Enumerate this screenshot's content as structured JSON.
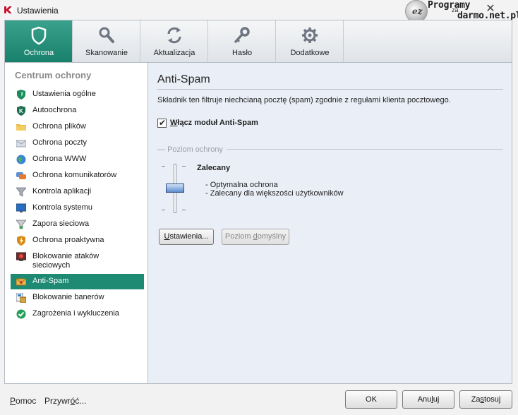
{
  "window": {
    "title": "Ustawienia",
    "close_glyph": "✕"
  },
  "watermark": {
    "logo_letter": "ez",
    "line1": "Programy",
    "line2": "za",
    "line3": "darmo.net.pl"
  },
  "tabs": [
    {
      "label": "Ochrona",
      "icon": "shield-icon",
      "active": true
    },
    {
      "label": "Skanowanie",
      "icon": "magnifier-icon",
      "active": false
    },
    {
      "label": "Aktualizacja",
      "icon": "refresh-icon",
      "active": false
    },
    {
      "label": "Hasło",
      "icon": "key-icon",
      "active": false
    },
    {
      "label": "Dodatkowe",
      "icon": "gear-icon",
      "active": false
    }
  ],
  "sidebar": {
    "title": "Centrum ochrony",
    "items": [
      {
        "label": "Ustawienia ogólne",
        "icon": "green-shield-icon"
      },
      {
        "label": "Autoochrona",
        "icon": "k-shield-icon"
      },
      {
        "label": "Ochrona plików",
        "icon": "folder-icon"
      },
      {
        "label": "Ochrona poczty",
        "icon": "envelope-icon"
      },
      {
        "label": "Ochrona WWW",
        "icon": "globe-icon"
      },
      {
        "label": "Ochrona komunikatorów",
        "icon": "chat-icon"
      },
      {
        "label": "Kontrola aplikacji",
        "icon": "funnel-icon"
      },
      {
        "label": "Kontrola systemu",
        "icon": "monitor-icon"
      },
      {
        "label": "Zapora sieciowa",
        "icon": "firewall-funnel-icon"
      },
      {
        "label": "Ochrona proaktywna",
        "icon": "proactive-shield-icon"
      },
      {
        "label": "Blokowanie ataków sieciowych",
        "icon": "network-attack-icon"
      },
      {
        "label": "Anti-Spam",
        "icon": "spam-envelope-icon",
        "active": true
      },
      {
        "label": "Blokowanie banerów",
        "icon": "banner-block-icon"
      },
      {
        "label": "Zagrożenia i wykluczenia",
        "icon": "check-circle-icon"
      }
    ]
  },
  "content": {
    "title": "Anti-Spam",
    "description": "Składnik ten filtruje niechcianą pocztę (spam) zgodnie z regułami klienta pocztowego.",
    "enable_checkbox": {
      "label": "Włącz moduł Anti-Spam",
      "checked": true
    },
    "protection_level": {
      "group_label": "Poziom ochrony",
      "level": "Zalecany",
      "level_index": 1,
      "level_count": 3,
      "desc1": "- Optymalna ochrona",
      "desc2": "- Zalecany dla większości użytkowników"
    },
    "settings_button": "Ustawienia...",
    "default_level_button": "Poziom domyślny"
  },
  "footer": {
    "help_link": "Pomoc",
    "restore_link": "Przywróć...",
    "ok_button": "OK",
    "cancel_button": "Anuluj",
    "apply_button": "Zastosuj"
  },
  "colors": {
    "accent": "#1f8a74",
    "content_bg": "#eaeef7"
  }
}
